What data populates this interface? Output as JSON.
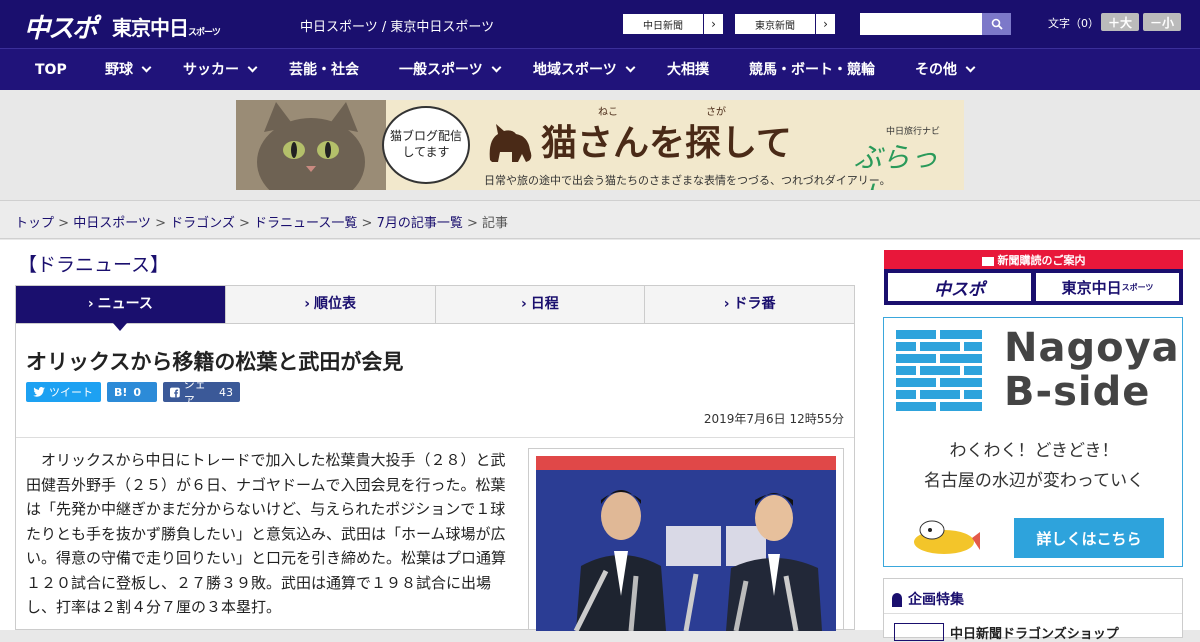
{
  "header": {
    "logo_chuspo": "中スポ",
    "logo_tokyo": "東京中日",
    "logo_tokyo_sub": "スポーツ",
    "site_name": "中日スポーツ / 東京中日スポーツ",
    "paper1": "中日新聞",
    "paper2": "東京新聞",
    "search_placeholder": "",
    "font_label": "文字（0）",
    "font_larger": "＋大",
    "font_smaller": "－小"
  },
  "nav": {
    "items": [
      {
        "label": "TOP",
        "dropdown": false
      },
      {
        "label": "野球",
        "dropdown": true
      },
      {
        "label": "サッカー",
        "dropdown": true
      },
      {
        "label": "芸能・社会",
        "dropdown": false
      },
      {
        "label": "一般スポーツ",
        "dropdown": true
      },
      {
        "label": "地域スポーツ",
        "dropdown": true
      },
      {
        "label": "大相撲",
        "dropdown": false
      },
      {
        "label": "競馬・ボート・競輪",
        "dropdown": false
      },
      {
        "label": "その他",
        "dropdown": true
      }
    ]
  },
  "ad": {
    "bubble": "猫ブログ配信してます",
    "title": "猫さんを探して",
    "ruby1": "ねこ",
    "ruby2": "さが",
    "subtitle": "日常や旅の途中で出会う猫たちのさまざまな表情をつづる、つれづれダイアリー。",
    "brand_small": "中日旅行ナビ",
    "brand": "ぶらっ人"
  },
  "breadcrumb": {
    "items": [
      "トップ",
      "中日スポーツ",
      "ドラゴンズ",
      "ドラニュース一覧",
      "7月の記事一覧"
    ],
    "current": "記事",
    "sep": " > "
  },
  "section": {
    "title": "【ドラニュース】"
  },
  "tabs": [
    {
      "label": "ニュース",
      "active": true
    },
    {
      "label": "順位表",
      "active": false
    },
    {
      "label": "日程",
      "active": false
    },
    {
      "label": "ドラ番",
      "active": false
    }
  ],
  "article": {
    "headline": "オリックスから移籍の松葉と武田が会見",
    "tweet": "ツイート",
    "hatena_count": "0",
    "share": "シェア",
    "share_count": "43",
    "date": "2019年7月6日 12時55分",
    "body": "オリックスから中日にトレードで加入した松葉貴大投手（２８）と武田健吾外野手（２５）が６日、ナゴヤドームで入団会見を行った。松葉は「先発か中継ぎかまだ分からないけど、与えられたポジションで１球たりとも手を抜かず勝負したい」と意気込み、武田は「ホーム球場が広い。得意の守備で走り回りたい」と口元を引き締めた。松葉はプロ通算１２０試合に登板し、２７勝３９敗。武田は通算で１９８試合に出場し、打率は２割４分７厘の３本塁打。"
  },
  "sidebar": {
    "sub_title": "新聞購読のご案内",
    "sub_logo1": "中スポ",
    "sub_logo2": "東京中日",
    "sub_logo2_small": "スポーツ",
    "bside_name1": "Nagoya",
    "bside_name2": "B-side",
    "bside_line1": "わくわく！どきどき！",
    "bside_line2": "名古屋の水辺が変わっていく",
    "bside_button": "詳しくはこちら",
    "kikaku_title": "企画特集",
    "kikaku_item": "中日新聞ドラゴンズショップ"
  },
  "colors": {
    "brand": "#1a0f6e",
    "nav": "#20137a",
    "accent_red": "#e8173a",
    "accent_blue": "#2ea3dc"
  },
  "icons": [
    "search-icon",
    "twitter-icon",
    "facebook-icon",
    "hatena-icon",
    "chevron-right-icon",
    "chevron-down-icon",
    "newspaper-icon",
    "ribbon-icon"
  ]
}
